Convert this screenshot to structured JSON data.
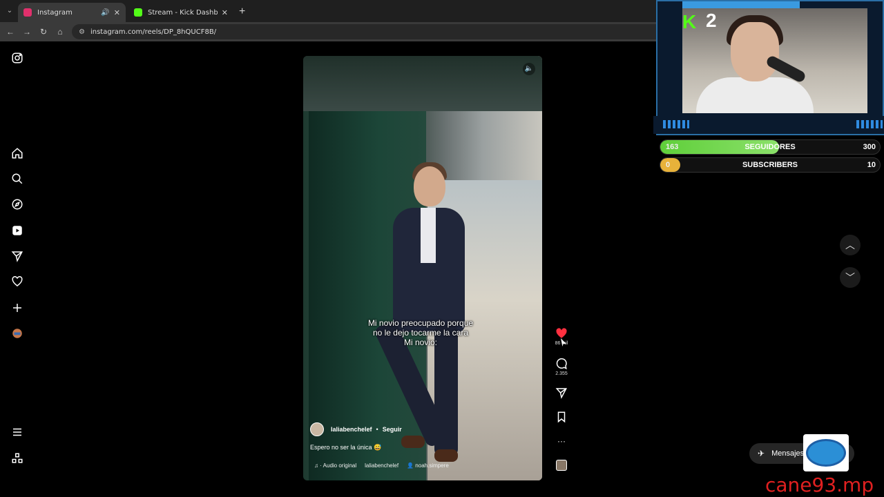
{
  "browser": {
    "tabs": [
      {
        "label": "Instagram",
        "active": true,
        "favicon_color": "#e1306c"
      },
      {
        "label": "Stream - Kick Dashboard",
        "active": false,
        "favicon_color": "#53fc18"
      }
    ],
    "url": "instagram.com/reels/DP_8hQUCF8B/"
  },
  "reel": {
    "caption_line1": "Mi novio preocupado porque",
    "caption_line2": "no le dejo tocarme la cara",
    "caption_line3": "Mi novio:",
    "author": "laliabenchelef",
    "separator": "•",
    "follow_label": "Seguir",
    "description": "Espero no ser la única 😅",
    "audio_label": "Audio original",
    "audio_author": "laliabenchelef",
    "tagged_user": "noah.simpere"
  },
  "actions": {
    "likes": "86 mil",
    "comments": "2.355",
    "like_color": "#ff3040"
  },
  "stream_overlay": {
    "level_number": "2",
    "followers_label": "SEGUIDORES",
    "followers_current": "163",
    "followers_goal": "300",
    "followers_progress": 0.54,
    "subs_label": "SUBSCRIBERS",
    "subs_current": "0",
    "subs_goal": "10",
    "subs_progress": 0.0,
    "follow_color": "#5fcf3a",
    "subs_color": "#e8b23a"
  },
  "messages_label": "Mensajes",
  "watermark": "cane93.mp"
}
